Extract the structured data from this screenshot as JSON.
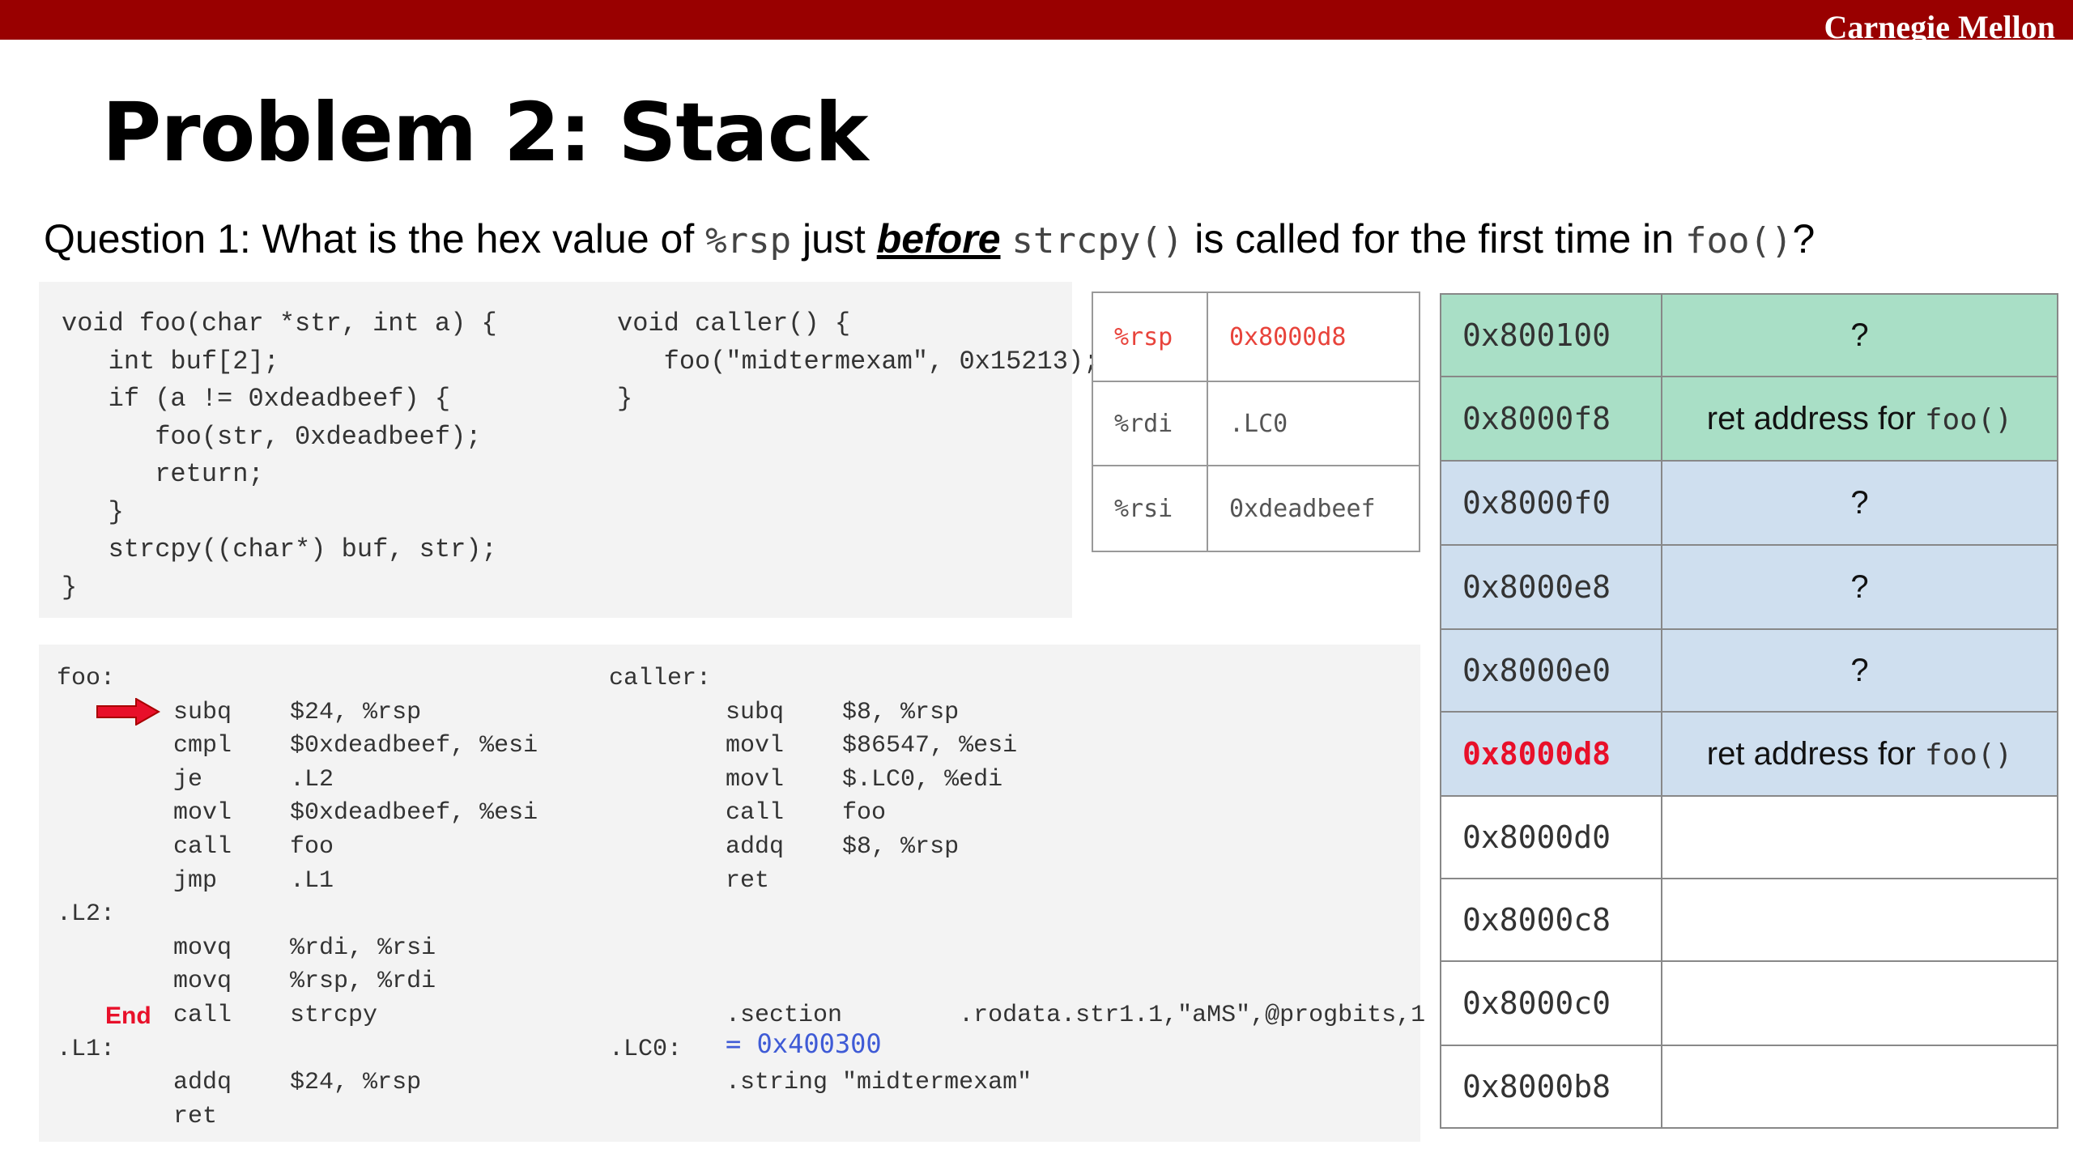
{
  "header": {
    "brand": "Carnegie Mellon"
  },
  "slide": {
    "title": "Problem 2: Stack",
    "question": {
      "prefix": "Question 1: What is the hex value of ",
      "reg": "%rsp",
      "mid1": " just ",
      "emph": "before",
      "mid2": " ",
      "func1": "strcpy()",
      "mid3": " is called for the first time in ",
      "func2": "foo()",
      "suffix": "?"
    }
  },
  "c_code": {
    "foo": "void foo(char *str, int a) {\n   int buf[2];\n   if (a != 0xdeadbeef) {\n      foo(str, 0xdeadbeef);\n      return;\n   }\n   strcpy((char*) buf, str);\n}",
    "caller": "void caller() {\n   foo(\"midtermexam\", 0x15213);\n}"
  },
  "asm_code": {
    "foo": "foo:\n        subq    $24, %rsp\n        cmpl    $0xdeadbeef, %esi\n        je      .L2\n        movl    $0xdeadbeef, %esi\n        call    foo\n        jmp     .L1\n.L2:\n        movq    %rdi, %rsi\n        movq    %rsp, %rdi\n        call    strcpy\n.L1:\n        addq    $24, %rsp\n        ret",
    "caller": "caller:\n        subq    $8, %rsp\n        movl    $86547, %esi\n        movl    $.LC0, %edi\n        call    foo\n        addq    $8, %rsp\n        ret\n\n\n\n        .section        .rodata.str1.1,\"aMS\",@progbits,1\n.LC0:\n        .string \"midtermexam\"",
    "end_label": "End",
    "lc0_annotation": "= 0x400300"
  },
  "registers": [
    {
      "name": "%rsp",
      "value": "0x8000d8"
    },
    {
      "name": "%rdi",
      "value": ".LC0"
    },
    {
      "name": "%rsi",
      "value": "0xdeadbeef"
    }
  ],
  "stack": [
    {
      "addr": "0x800100",
      "text": "?",
      "code": ""
    },
    {
      "addr": "0x8000f8",
      "text": "ret address for ",
      "code": "foo()"
    },
    {
      "addr": "0x8000f0",
      "text": "?",
      "code": ""
    },
    {
      "addr": "0x8000e8",
      "text": "?",
      "code": ""
    },
    {
      "addr": "0x8000e0",
      "text": "?",
      "code": ""
    },
    {
      "addr": "0x8000d8",
      "text": "ret address for ",
      "code": "foo()"
    },
    {
      "addr": "0x8000d0",
      "text": "",
      "code": ""
    },
    {
      "addr": "0x8000c8",
      "text": "",
      "code": ""
    },
    {
      "addr": "0x8000c0",
      "text": "",
      "code": ""
    },
    {
      "addr": "0x8000b8",
      "text": "",
      "code": ""
    }
  ],
  "colors": {
    "header": "#990000",
    "stack_green": "#a9dfc6",
    "stack_blue": "#cfdfef",
    "highlight_red": "#e8102a",
    "annotation_blue": "#3f5bd6"
  },
  "icons": {
    "pointer": "right-arrow-icon"
  }
}
